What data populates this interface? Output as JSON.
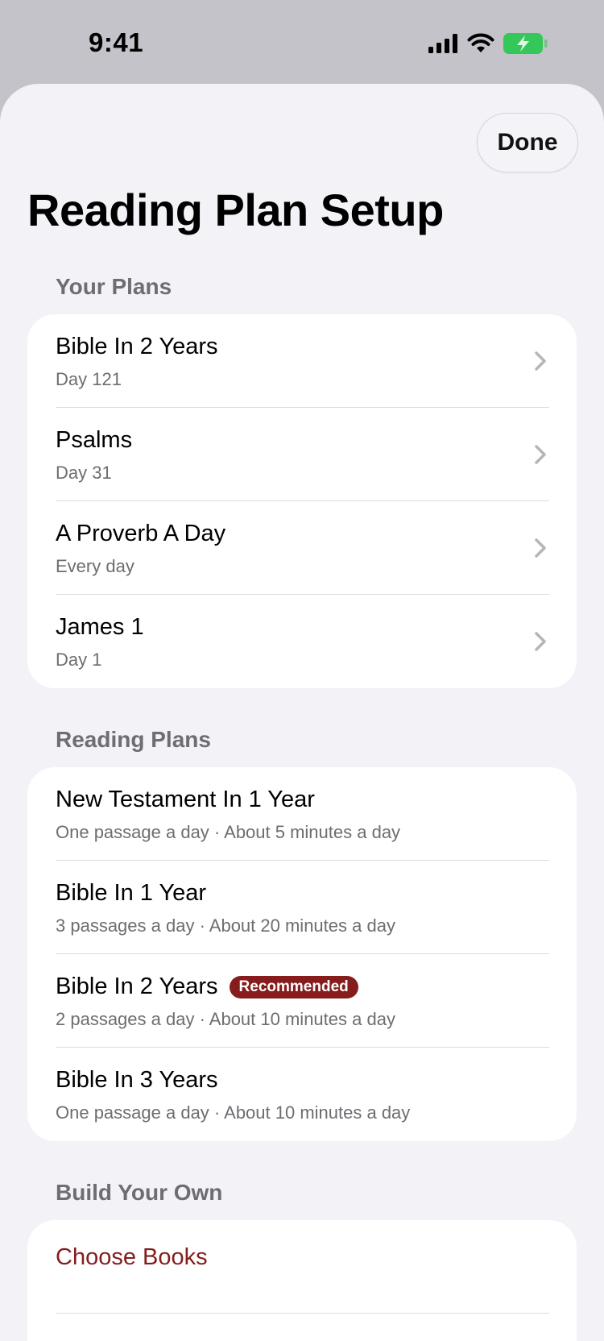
{
  "status": {
    "time": "9:41"
  },
  "header": {
    "title": "Reading Plan Setup",
    "done_label": "Done"
  },
  "your_plans": {
    "header": "Your Plans",
    "items": [
      {
        "title": "Bible In 2 Years",
        "subtitle": "Day 121"
      },
      {
        "title": "Psalms",
        "subtitle": "Day 31"
      },
      {
        "title": "A Proverb A Day",
        "subtitle": "Every day"
      },
      {
        "title": "James 1",
        "subtitle": "Day 1"
      }
    ]
  },
  "reading_plans": {
    "header": "Reading Plans",
    "items": [
      {
        "title": "New Testament In 1 Year",
        "subtitle": "One passage a day · About 5 minutes a day"
      },
      {
        "title": "Bible In 1 Year",
        "subtitle": "3 passages a day · About 20 minutes a day"
      },
      {
        "title": "Bible In 2 Years",
        "badge": "Recommended",
        "subtitle": "2 passages a day · About 10 minutes a day"
      },
      {
        "title": "Bible In 3 Years",
        "subtitle": "One passage a day · About 10 minutes a day"
      }
    ]
  },
  "build_your_own": {
    "header": "Build Your Own",
    "choose_books_label": "Choose Books"
  },
  "colors": {
    "accent": "#841d1d",
    "badge": "#861c1c",
    "battery": "#34c759"
  }
}
